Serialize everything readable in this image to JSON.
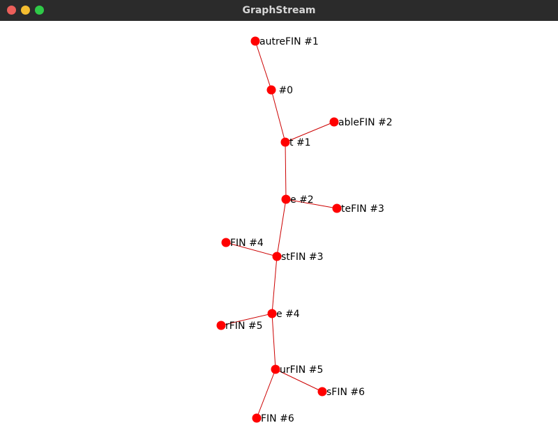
{
  "window": {
    "title": "GraphStream"
  },
  "graph": {
    "node_color": "#ff0000",
    "edge_color": "#cc0000",
    "nodes": [
      {
        "id": "n_autre",
        "label": "autreFIN #1"
      },
      {
        "id": "n_0",
        "label": " #0"
      },
      {
        "id": "n_t1",
        "label": "t #1"
      },
      {
        "id": "n_able",
        "label": "ableFIN #2"
      },
      {
        "id": "n_e2",
        "label": "e #2"
      },
      {
        "id": "n_te",
        "label": "teFIN #3"
      },
      {
        "id": "n_st",
        "label": "stFIN #3"
      },
      {
        "id": "n_fin4",
        "label": "FIN #4"
      },
      {
        "id": "n_e4",
        "label": "e #4"
      },
      {
        "id": "n_r",
        "label": "rFIN #5"
      },
      {
        "id": "n_ur",
        "label": "urFIN #5"
      },
      {
        "id": "n_s",
        "label": "sFIN #6"
      },
      {
        "id": "n_fin6",
        "label": "FIN #6"
      }
    ],
    "edges": [
      [
        "n_autre",
        "n_0"
      ],
      [
        "n_0",
        "n_t1"
      ],
      [
        "n_t1",
        "n_able"
      ],
      [
        "n_t1",
        "n_e2"
      ],
      [
        "n_e2",
        "n_te"
      ],
      [
        "n_e2",
        "n_st"
      ],
      [
        "n_st",
        "n_fin4"
      ],
      [
        "n_st",
        "n_e4"
      ],
      [
        "n_e4",
        "n_r"
      ],
      [
        "n_e4",
        "n_ur"
      ],
      [
        "n_ur",
        "n_s"
      ],
      [
        "n_ur",
        "n_fin6"
      ]
    ]
  }
}
